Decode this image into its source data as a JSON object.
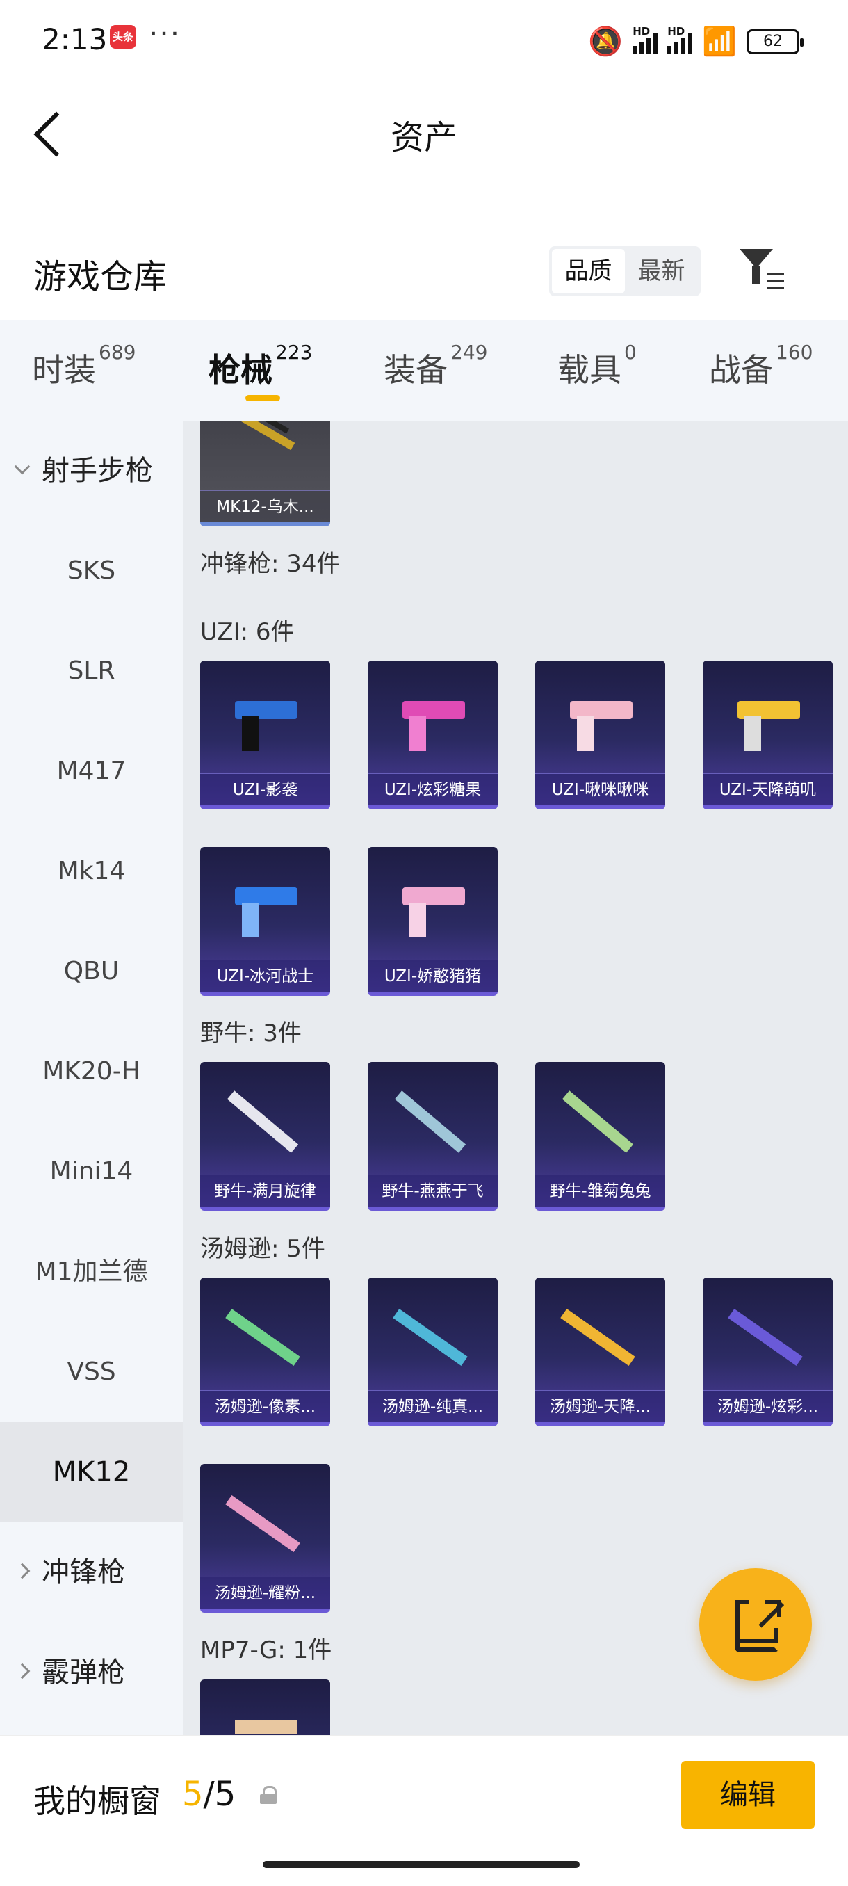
{
  "status_bar": {
    "time": "2:13",
    "app_badge": "头条",
    "more": "···",
    "hd1": "HD",
    "hd2": "HD",
    "battery": "62"
  },
  "nav": {
    "title": "资产"
  },
  "section": {
    "title": "游戏仓库",
    "sort_options": [
      "品质",
      "最新"
    ],
    "sort_selected": "品质"
  },
  "tabs": [
    {
      "label": "时装",
      "count": "689"
    },
    {
      "label": "枪械",
      "count": "223",
      "active": true
    },
    {
      "label": "装备",
      "count": "249"
    },
    {
      "label": "载具",
      "count": "0"
    },
    {
      "label": "战备",
      "count": "160"
    }
  ],
  "sidebar": {
    "group_open": "射手步枪",
    "items": [
      "SKS",
      "SLR",
      "M417",
      "Mk14",
      "QBU",
      "MK20-H",
      "Mini14",
      "M1加兰德",
      "VSS",
      "MK12"
    ],
    "active_item": "MK12",
    "collapsed_groups": [
      "冲锋枪",
      "霰弹枪"
    ]
  },
  "content": {
    "top_card": "MK12-乌木...",
    "category_heading": "冲锋枪: 34件",
    "groups": [
      {
        "heading": "UZI: 6件",
        "items": [
          "UZI-影袭",
          "UZI-炫彩糖果",
          "UZI-啾咪啾咪",
          "UZI-天降萌叽",
          "UZI-冰河战士",
          "UZI-娇憨猪猪"
        ]
      },
      {
        "heading": "野牛: 3件",
        "items": [
          "野牛-满月旋律",
          "野牛-燕燕于飞",
          "野牛-雏菊兔兔"
        ]
      },
      {
        "heading": "汤姆逊: 5件",
        "items": [
          "汤姆逊-像素...",
          "汤姆逊-纯真...",
          "汤姆逊-天降...",
          "汤姆逊-炫彩...",
          "汤姆逊-耀粉..."
        ]
      },
      {
        "heading": "MP7-G: 1件",
        "items": [
          ""
        ]
      }
    ]
  },
  "fab": {
    "icon": "share-external-icon"
  },
  "bottom_bar": {
    "label": "我的橱窗",
    "count_current": "5",
    "count_sep": "/",
    "count_total": "5",
    "edit_label": "编辑"
  },
  "colors": {
    "accent": "#f6b400",
    "card_bg": "#2b2a62",
    "content_bg": "#e8ebef",
    "sidebar_bg": "#f3f6fa"
  }
}
